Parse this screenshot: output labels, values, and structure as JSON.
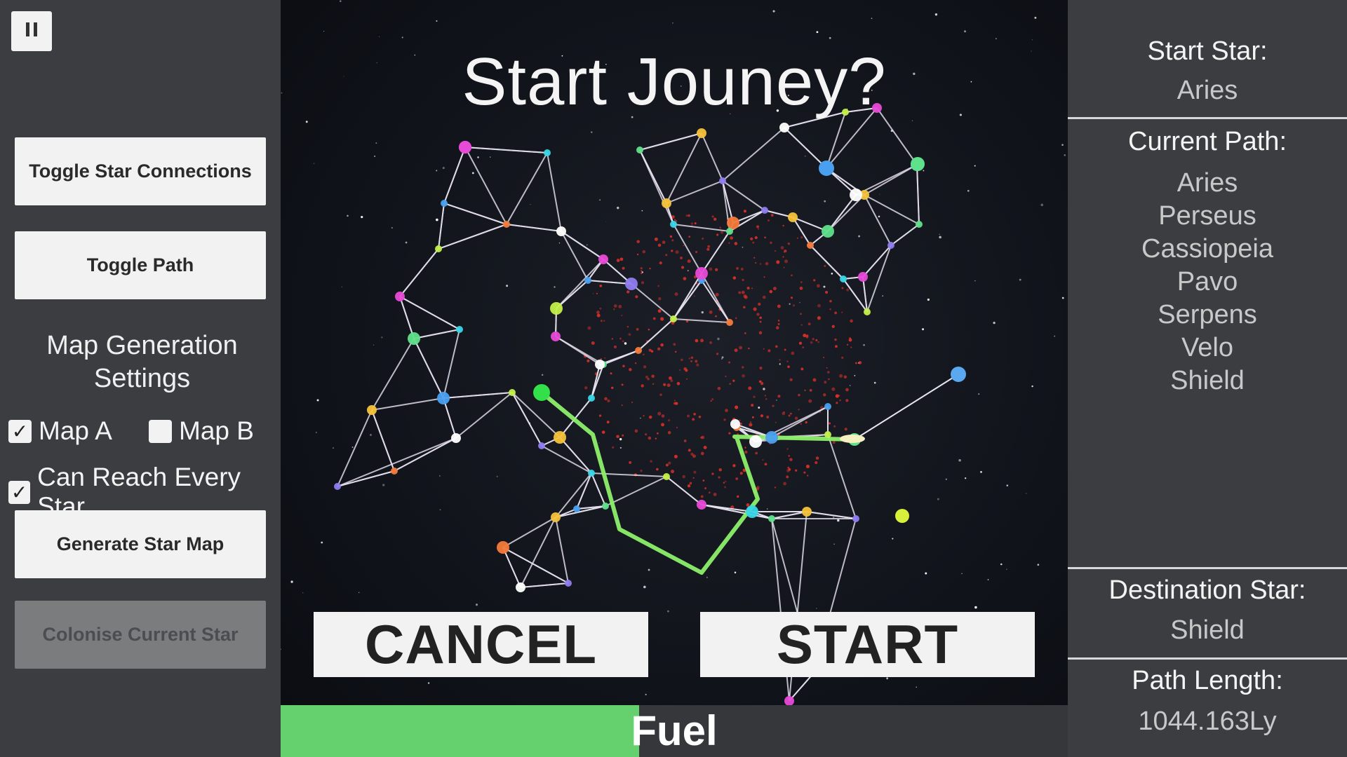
{
  "left": {
    "toggle_connections": "Toggle Star Connections",
    "toggle_path": "Toggle Path",
    "settings_title_1": "Map Generation",
    "settings_title_2": "Settings",
    "map_a": "Map A",
    "map_b": "Map B",
    "reach_every": "Can Reach Every Star",
    "generate": "Generate Star Map",
    "colonise": "Colonise Current Star"
  },
  "center": {
    "headline": "Start Jouney?",
    "cancel": "CANCEL",
    "start": "START",
    "fuel_label": "Fuel",
    "fuel_level": 0.455
  },
  "right": {
    "start_label": "Start Star:",
    "start_value": "Aries",
    "path_label": "Current Path:",
    "path": [
      "Aries",
      "Perseus",
      "Cassiopeia",
      "Pavo",
      "Serpens",
      "Velo",
      "Shield"
    ],
    "dest_label": "Destination Star:",
    "dest_value": "Shield",
    "length_label": "Path Length:",
    "length_value": "1044.163Ly"
  },
  "colors": {
    "panel": "#3b3d40",
    "fuel": "#65d06e",
    "path_line": "#8cf06a",
    "nebula": "#e0302a"
  }
}
